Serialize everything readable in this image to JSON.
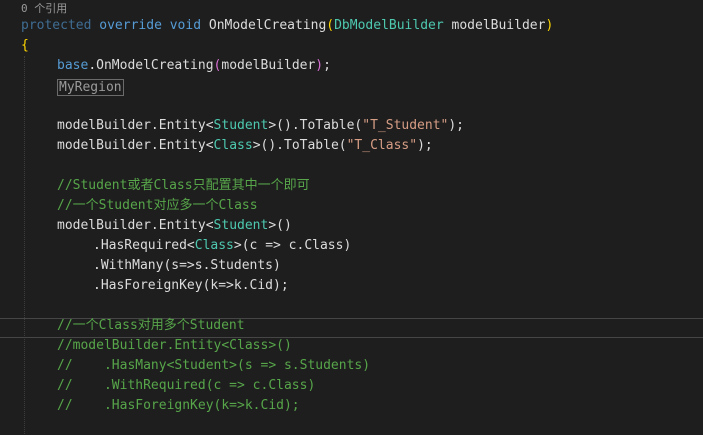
{
  "codelens": "0 个引用",
  "colors": {
    "background": "#1e1e1e",
    "keyword": "#569cd6",
    "type": "#4ec9b0",
    "string": "#d69d85",
    "comment": "#57a64a",
    "text": "#dcdcdc"
  },
  "code": {
    "l2_protected": "protected",
    "l2_override": "override",
    "l2_void": "void",
    "l2_method": "OnModelCreating",
    "l2_open": "(",
    "l2_type": "DbModelBuilder",
    "l2_param": " modelBuilder",
    "l2_close": ")",
    "l3_brace": "{",
    "l4_base": "base",
    "l4_rest": ".OnModelCreating",
    "l4_open": "(",
    "l4_arg": "modelBuilder",
    "l4_close": ")",
    "l4_semi": ";",
    "l5_region": "MyRegion",
    "l6_pre": "modelBuilder.Entity<",
    "l6_type": "Student",
    "l6_mid": ">().ToTable(",
    "l6_str": "\"T_Student\"",
    "l6_end": ");",
    "l7_pre": "modelBuilder.Entity<",
    "l7_type": "Class",
    "l7_mid": ">().ToTable(",
    "l7_str": "\"T_Class\"",
    "l7_end": ");",
    "l8_comment": "//Student或者Class只配置其中一个即可",
    "l9_comment": "//一个Student对应多一个Class",
    "l10_pre": "modelBuilder.Entity<",
    "l10_type": "Student",
    "l10_end": ">()",
    "l11_pre": ".HasRequired<",
    "l11_type": "Class",
    "l11_end": ">(c => c.Class)",
    "l12_text": ".WithMany(s=>s.Students)",
    "l13_text": ".HasForeignKey(k=>k.Cid);",
    "l14_comment": "//一个Class对用多个Student",
    "l15_comment": "//modelBuilder.Entity<Class>()",
    "l16_comment": "//    .HasMany<Student>(s => s.Students)",
    "l17_comment": "//    .WithRequired(c => c.Class)",
    "l18_comment": "//    .HasForeignKey(k=>k.Cid);"
  }
}
